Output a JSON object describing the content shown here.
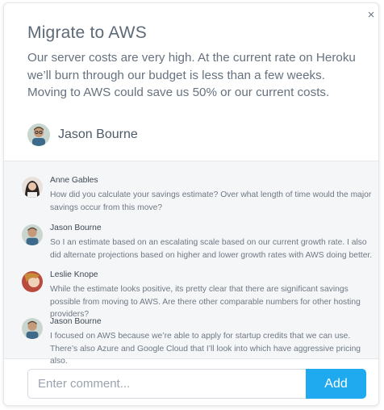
{
  "card": {
    "title": "Migrate to AWS",
    "description": "Our server costs are very high. At the current rate on Heroku we’ll burn through our budget is less than a few weeks. Moving to AWS could save us 50% or our current costs.",
    "author": "Jason Bourne",
    "close_icon": "close-icon"
  },
  "comments": [
    {
      "author": "Anne Gables",
      "text": "How did you calculate your savings estimate? Over what length of time would the major savings occur from this move?"
    },
    {
      "author": "Jason Bourne",
      "text": "So I an estimate based on an escalating scale based on our current growth rate. I also did alternate projections based on higher and lower growth rates with AWS doing better."
    },
    {
      "author": "Leslie Knope",
      "text": "While the estimate looks positive, its pretty clear that there are significant savings possible from moving to AWS. Are there other comparable numbers for other hosting providers?"
    },
    {
      "author": "Jason Bourne",
      "text": "I focused on AWS because we’re able to apply for startup credits that we can use. There’s also Azure and Google Cloud that I’ll look into which have aggressive pricing also."
    }
  ],
  "input": {
    "placeholder": "Enter comment...",
    "value": "",
    "add_label": "Add"
  },
  "colors": {
    "accent": "#1faaf0",
    "panel": "#f5f6f8"
  }
}
